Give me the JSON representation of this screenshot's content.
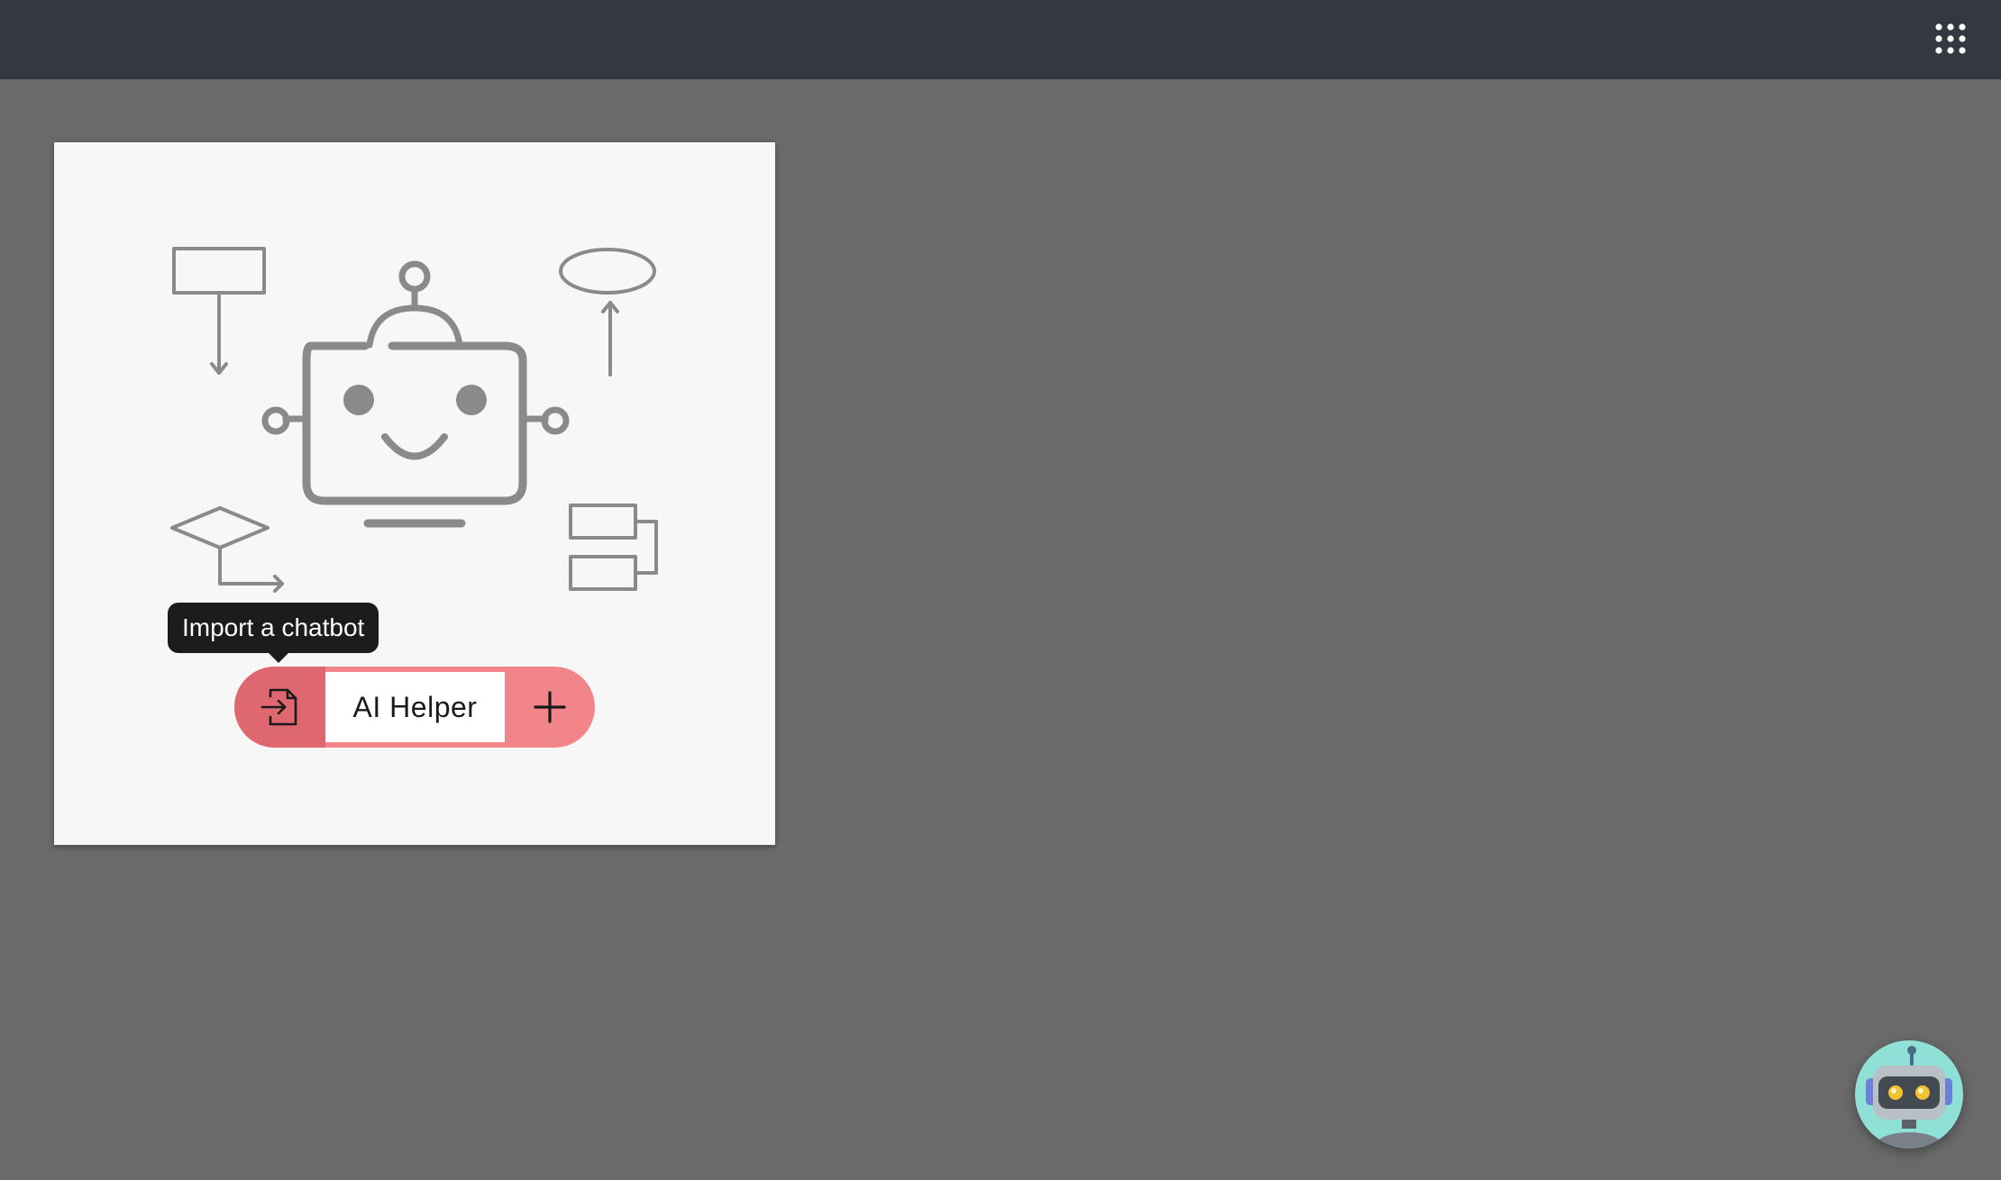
{
  "topbar": {
    "apps_icon": "grid-apps-icon"
  },
  "card": {
    "illustration_icon": "robot-flowchart-illustration",
    "tooltip": "Import a chatbot",
    "chatbot": {
      "import_icon": "file-import-icon",
      "name": "AI Helper",
      "add_icon": "plus-icon"
    }
  },
  "assistant": {
    "icon": "robot-assistant-icon"
  },
  "colors": {
    "topbar": "#343841",
    "background": "#6a6a6a",
    "card": "#f7f7f7",
    "pill": "#f2858a",
    "pill_import": "#df6870",
    "tooltip": "#1c1c1c",
    "assistant_bg": "#8fe0d6"
  }
}
